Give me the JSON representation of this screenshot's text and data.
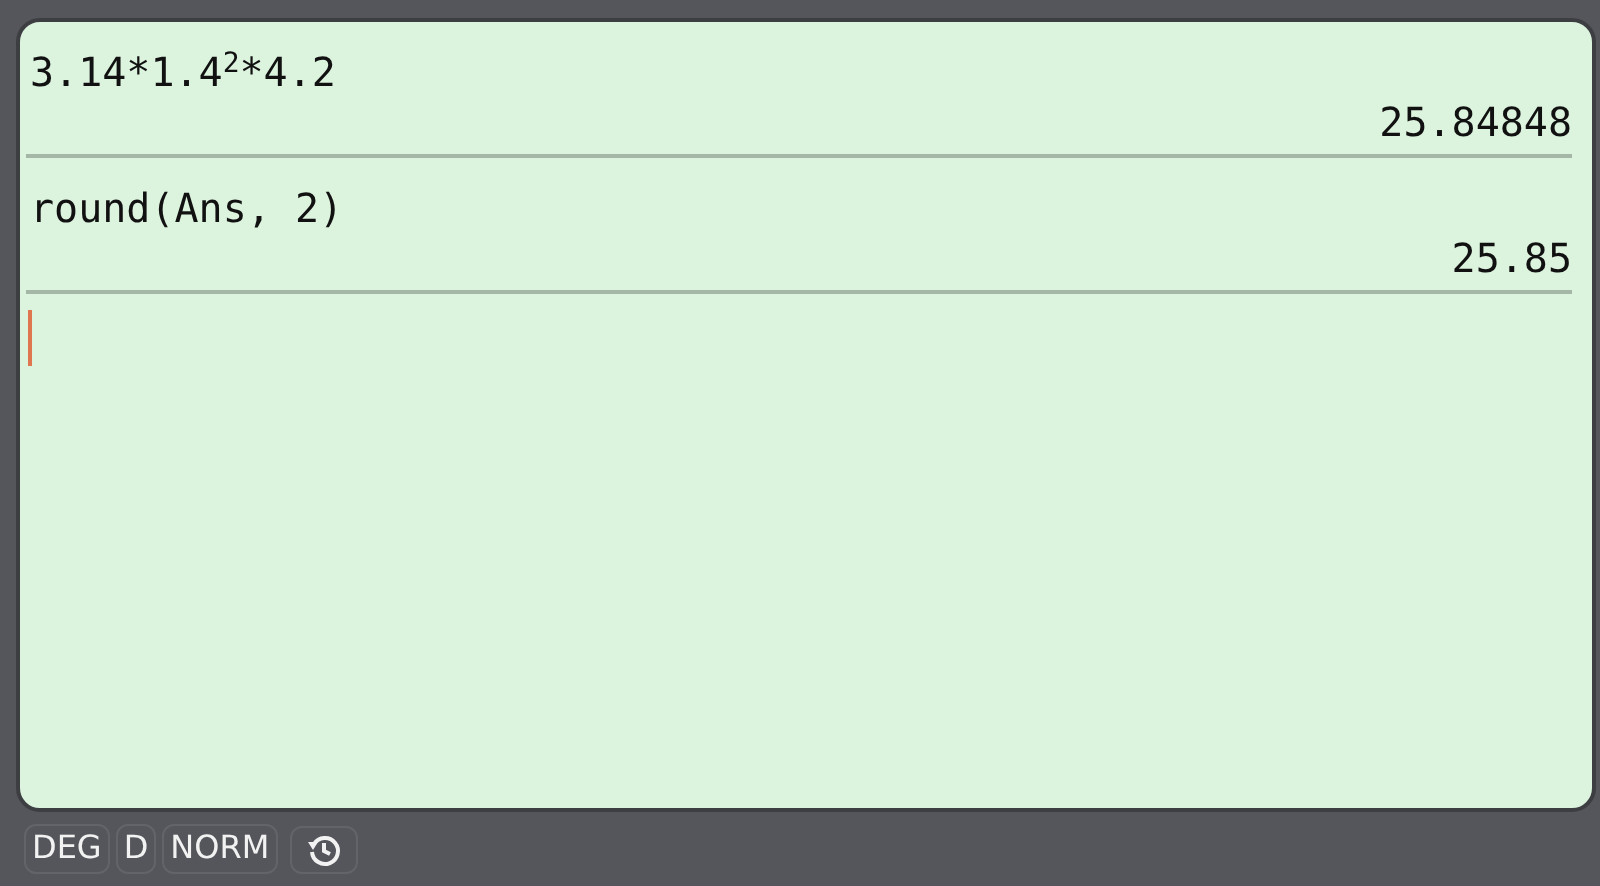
{
  "history": [
    {
      "expression": "3.14*1.4$^{2}$*4.2",
      "result": "25.84848"
    },
    {
      "expression": "round(Ans, 2)",
      "result": "25.85"
    }
  ],
  "input": {
    "focused": true
  },
  "status_bar": {
    "modes": [
      "DEG",
      "D",
      "NORM"
    ]
  }
}
